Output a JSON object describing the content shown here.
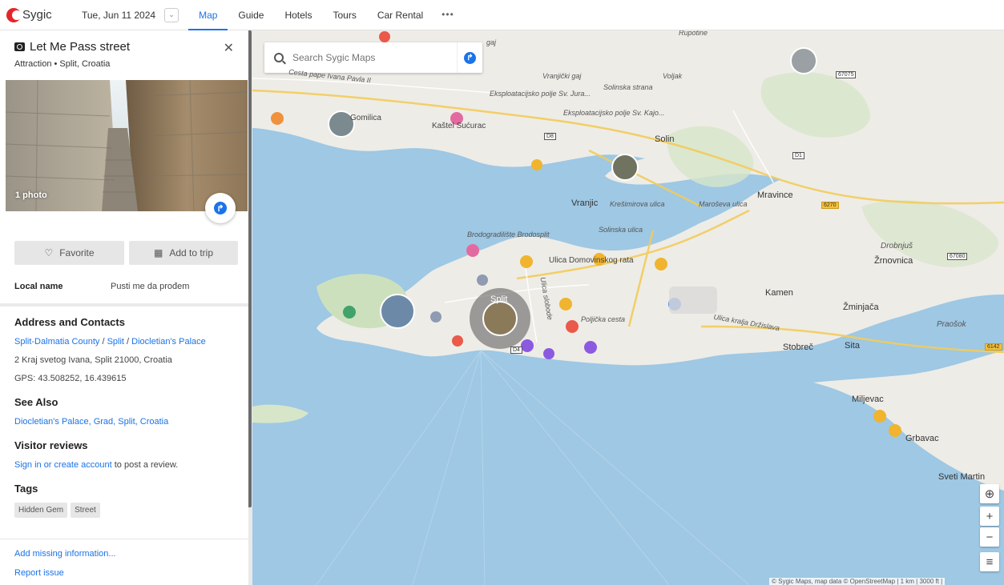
{
  "app": {
    "logo_text": "Sygic"
  },
  "topbar": {
    "date": "Tue, Jun 11 2024",
    "nav": [
      "Map",
      "Guide",
      "Hotels",
      "Tours",
      "Car Rental"
    ],
    "more": "•••"
  },
  "place": {
    "title": "Let Me Pass street",
    "subtitle": "Attraction • Split, Croatia",
    "photo_count": "1 photo",
    "favorite_label": "Favorite",
    "add_to_trip_label": "Add to trip",
    "local_name_key": "Local name",
    "local_name_value": "Pusti me da prođem"
  },
  "address": {
    "heading": "Address and Contacts",
    "breadcrumb": [
      "Split-Dalmatia County",
      "Split",
      "Diocletian's Palace"
    ],
    "street": "2 Kraj svetog Ivana, Split 21000, Croatia",
    "gps": "GPS: 43.508252, 16.439615"
  },
  "see_also": {
    "heading": "See Also",
    "link": "Diocletian's Palace, Grad, Split, Croatia"
  },
  "reviews": {
    "heading": "Visitor reviews",
    "link": "Sign in or create account",
    "rest": " to post a review."
  },
  "tags": {
    "heading": "Tags",
    "items": [
      "Hidden Gem",
      "Street"
    ]
  },
  "footer": {
    "add_missing": "Add missing information...",
    "report": "Report issue"
  },
  "map": {
    "search_placeholder": "Search Sygic Maps",
    "labels": {
      "vranjicki_gaj": "Vranjički gaj",
      "voljak": "Voljak",
      "solinska_strana": "Solinska strana",
      "eksp1": "Eksploatacijsko polje Sv. Jura...",
      "eksp2": "Eksploatacijsko polje Sv. Kajo...",
      "solin": "Solin",
      "kastel": "Kaštel Sućurac",
      "gomilica": "Gomilica",
      "vranjic": "Vranjic",
      "mravince": "Mravince",
      "brodo": "Brodogradilište Brodosplit",
      "solinska_ulica": "Solinska ulica",
      "ulica_domovinskog": "Ulica Domovinskog rata",
      "kamen": "Kamen",
      "drobnjus": "Drobnjuš",
      "zrnovnica": "Žrnovnica",
      "zminjaca": "Žminjača",
      "praosok": "Praošok",
      "split": "Split",
      "stobrec": "Stobreč",
      "sita": "Sita",
      "miljevac": "Miljevac",
      "grbavac": "Grbavac",
      "sveti_martin": "Sveti Martin",
      "cesta_pape": "Cesta pape Ivana Pavla II",
      "kresimirova": "Krešimirova ulica",
      "maroseva": "Maroševa ulica",
      "poljicka": "Poljička cesta",
      "kralja": "Ulica kralja Držislava",
      "ulica_stop": "Ulica slobode",
      "rupotine": "Rupotine",
      "gaj": "gaj"
    },
    "badges": {
      "d8": "D8",
      "d1": "D1",
      "r67075": "67075",
      "r6270": "6270",
      "r67080": "67080",
      "r6142": "6142",
      "d4": "D4"
    },
    "attribution": "© Sygic Maps, map data © OpenStreetMap  |  1 km  |  3000 ft  |",
    "zoom_in": "+",
    "zoom_out": "−"
  },
  "colors": {
    "accent": "#1a73e8",
    "water": "#9ec8e4",
    "land": "#eeece7",
    "brand": "#e4262b"
  }
}
